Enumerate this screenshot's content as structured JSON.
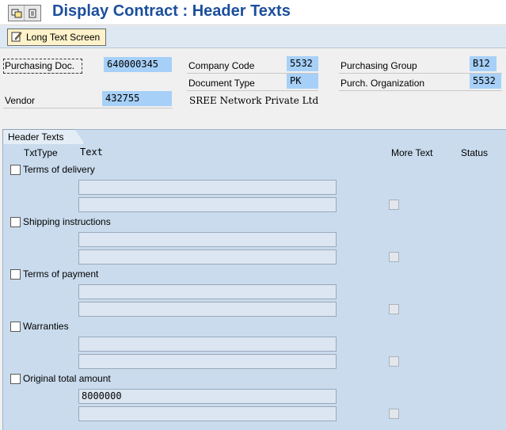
{
  "window": {
    "title": "Display Contract : Header Texts",
    "icons": [
      "other-object-icon",
      "document-icon"
    ]
  },
  "toolbar": {
    "long_text_label": "Long Text Screen",
    "long_text_icon": "pencil-icon"
  },
  "header": {
    "purchasing_doc_label": "Purchasing Doc.",
    "purchasing_doc_value": "640000345",
    "company_code_label": "Company Code",
    "company_code_value": "5532",
    "purchasing_group_label": "Purchasing Group",
    "purchasing_group_value": "B12",
    "document_type_label": "Document Type",
    "document_type_value": "PK",
    "purch_org_label": "Purch. Organization",
    "purch_org_value": "5532",
    "vendor_label": "Vendor",
    "vendor_value": "432755",
    "vendor_name": "SREE Network Private Ltd"
  },
  "header_texts": {
    "tab_label": "Header Texts",
    "col_txttype": "TxtType",
    "col_text": "Text",
    "col_more_text": "More Text",
    "col_status": "Status",
    "rows": [
      {
        "label": "Terms of delivery",
        "line1": "",
        "line2": ""
      },
      {
        "label": "Shipping instructions",
        "line1": "",
        "line2": ""
      },
      {
        "label": "Terms of payment",
        "line1": "",
        "line2": ""
      },
      {
        "label": "Warranties",
        "line1": "",
        "line2": ""
      },
      {
        "label": "Original total amount",
        "line1": "8000000",
        "line2": ""
      }
    ]
  },
  "colors": {
    "title": "#1b4f9c",
    "field_highlight": "#a7d0f8",
    "panel_bg": "#c9dbed",
    "button_bg": "#fdf2c9"
  }
}
